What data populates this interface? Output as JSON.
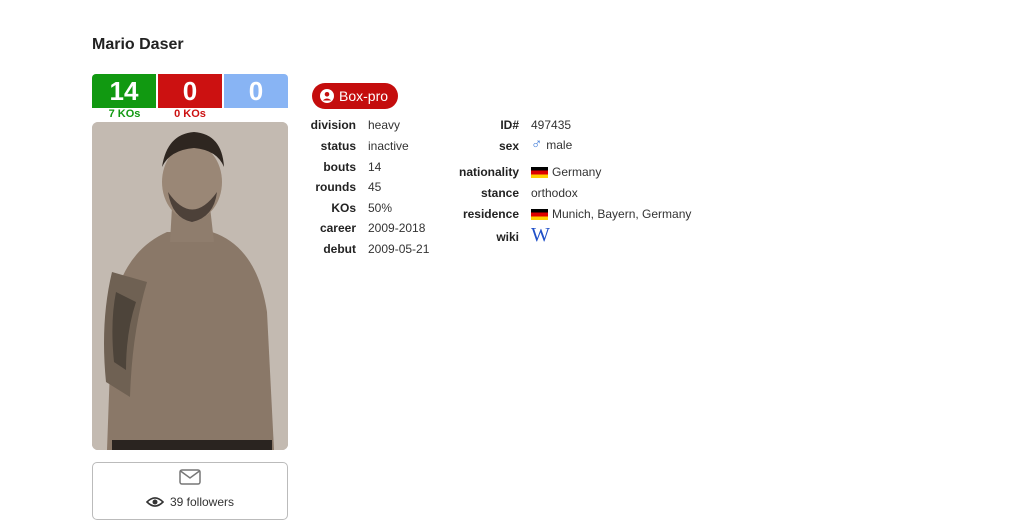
{
  "boxer": {
    "name": "Mario Daser",
    "record": {
      "wins": "14",
      "losses": "0",
      "draws": "0",
      "wins_kos": "7 KOs",
      "losses_kos": "0 KOs"
    },
    "badge": "Box-pro",
    "followers": "39 followers"
  },
  "details_left": {
    "division": {
      "label": "division",
      "value": "heavy"
    },
    "status": {
      "label": "status",
      "value": "inactive"
    },
    "bouts": {
      "label": "bouts",
      "value": "14"
    },
    "rounds": {
      "label": "rounds",
      "value": "45"
    },
    "kos": {
      "label": "KOs",
      "value": "50%"
    },
    "career": {
      "label": "career",
      "value": "2009-2018"
    },
    "debut": {
      "label": "debut",
      "value": "2009-05-21"
    }
  },
  "details_right": {
    "id": {
      "label": "ID#",
      "value": "497435"
    },
    "sex": {
      "label": "sex",
      "value": "male",
      "icon": "male-symbol-icon"
    },
    "nationality": {
      "label": "nationality",
      "value": "Germany",
      "icon": "germany-flag-icon"
    },
    "stance": {
      "label": "stance",
      "value": "orthodox"
    },
    "residence": {
      "label": "residence",
      "value": "Munich, Bayern, Germany",
      "icon": "germany-flag-icon"
    },
    "wiki": {
      "label": "wiki",
      "value": "W",
      "icon": "wikipedia-icon"
    }
  },
  "colors": {
    "win": "#119911",
    "loss": "#cc1111",
    "draw": "#88b4f4",
    "badge": "#c40d0d",
    "link": "#3a78d8"
  }
}
